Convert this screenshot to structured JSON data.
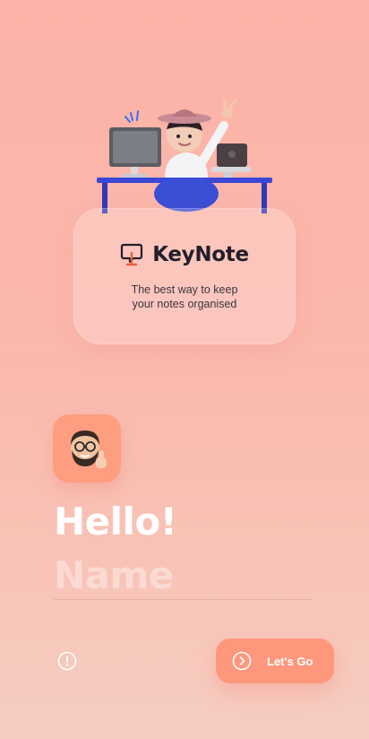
{
  "app": {
    "name": "KeyNote",
    "tagline_line1": "The best way to keep",
    "tagline_line2": "your notes organised"
  },
  "greeting": {
    "text": "Hello!",
    "name_placeholder": "Name",
    "name_value": ""
  },
  "actions": {
    "primary_label": "Let's Go"
  },
  "icons": {
    "logo": "chat-bubble-logo-icon",
    "avatar": "bearded-man-thumbs-up-avatar",
    "info": "exclamation-circle-icon",
    "go": "chevron-right-circle-icon"
  },
  "colors": {
    "accent": "#ff977c",
    "logo_accent": "#e8603a",
    "text_dark": "#231f2a",
    "background_top": "#fdb3a7",
    "background_bottom": "#f6cdc2"
  }
}
